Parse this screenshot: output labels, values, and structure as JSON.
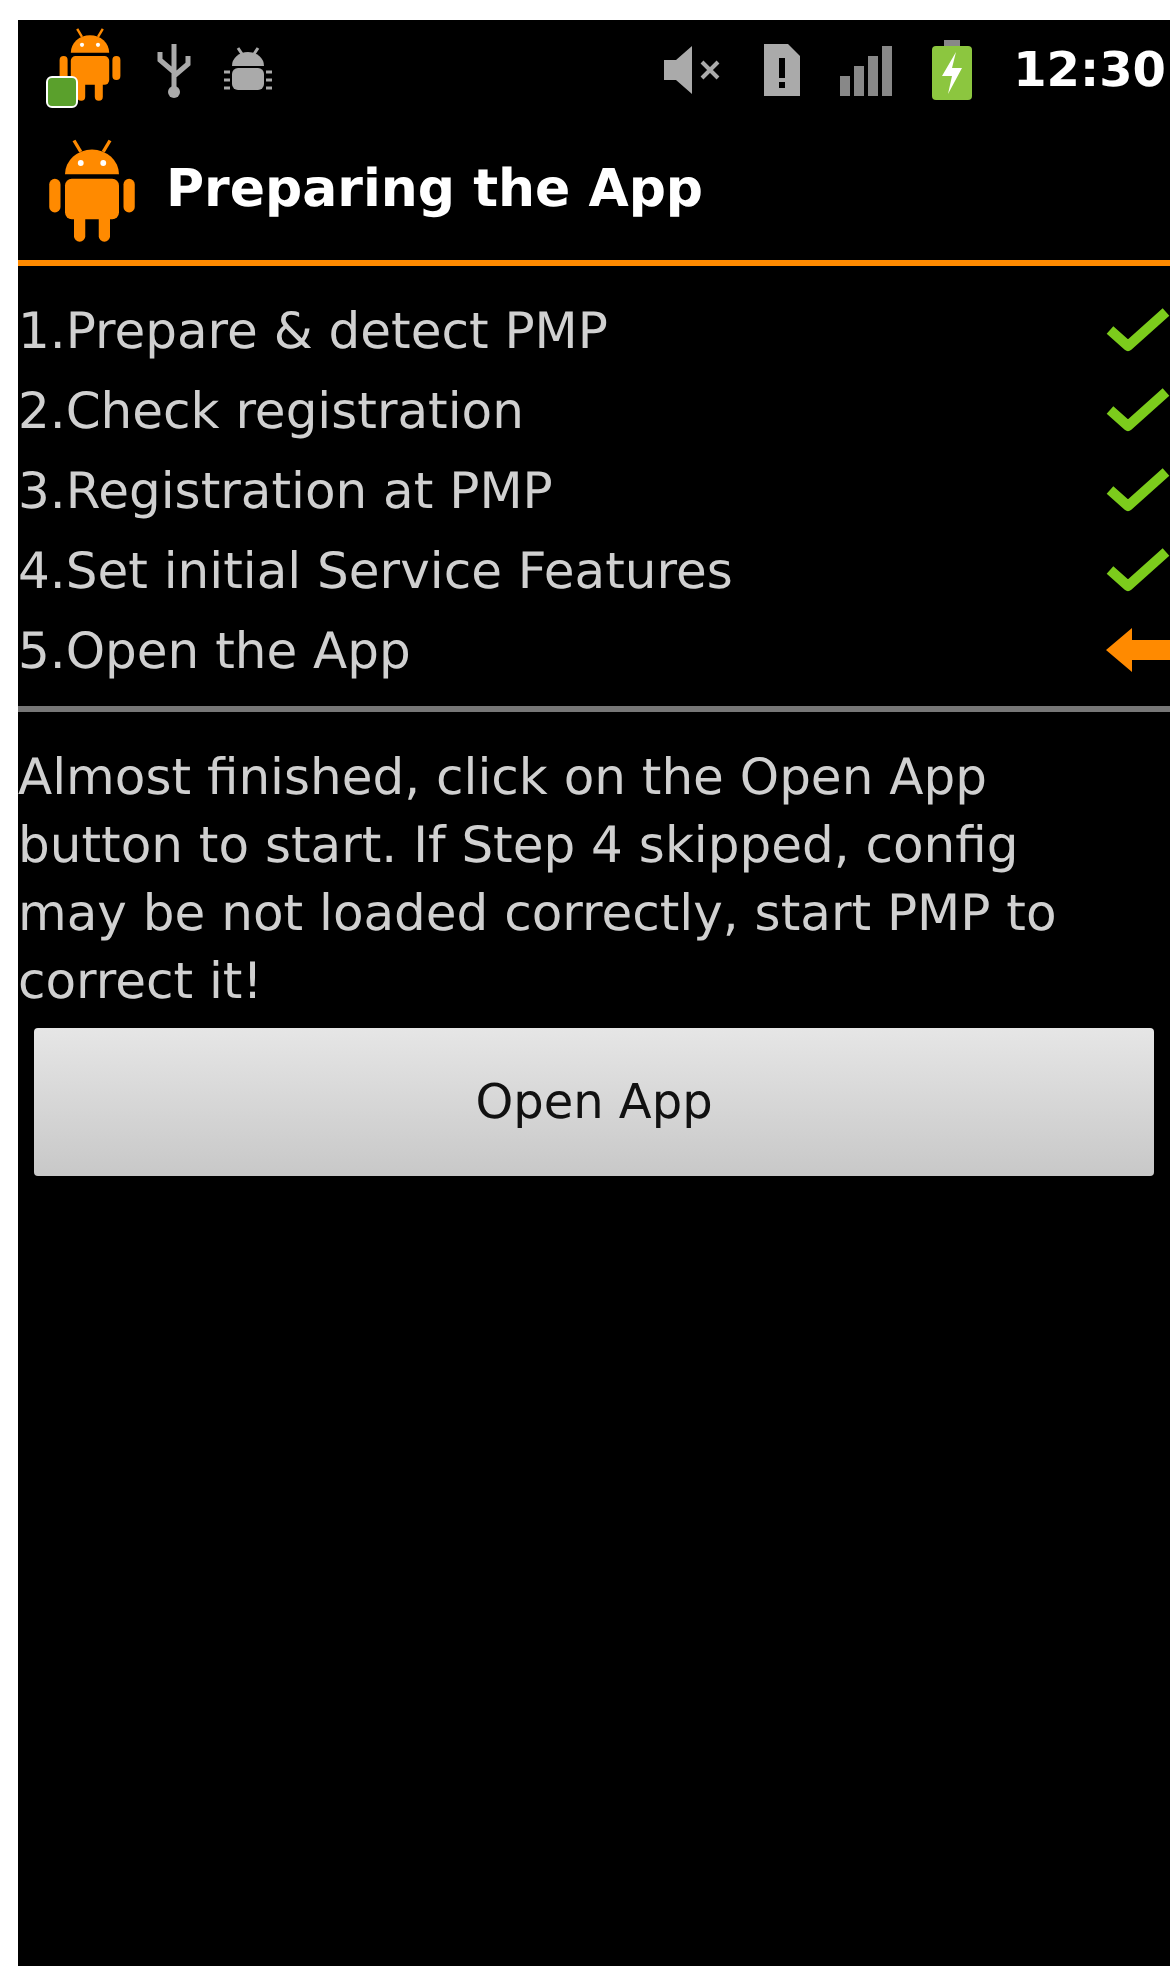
{
  "status_bar": {
    "time": "12:30",
    "battery_charging": true
  },
  "title": "Preparing the App",
  "steps": [
    {
      "label": "1.Prepare & detect PMP",
      "kind": "done"
    },
    {
      "label": "2.Check registration",
      "kind": "done"
    },
    {
      "label": "3.Registration at PMP",
      "kind": "done"
    },
    {
      "label": "4.Set initial Service Features",
      "kind": "done"
    },
    {
      "label": "5.Open the App",
      "kind": "current"
    }
  ],
  "message": "Almost finished, click on the Open App button to start. If Step 4 skipped, config may be not loaded correctly, start PMP to correct it!",
  "button": "Open App"
}
